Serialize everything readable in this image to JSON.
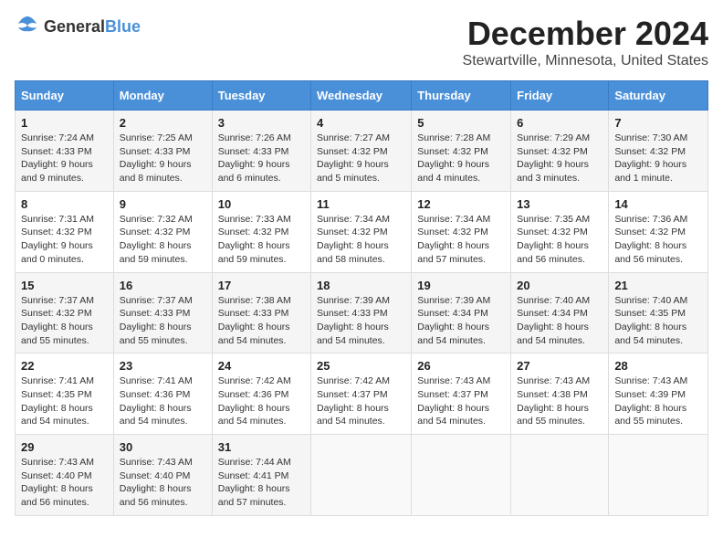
{
  "header": {
    "logo_general": "General",
    "logo_blue": "Blue",
    "title": "December 2024",
    "subtitle": "Stewartville, Minnesota, United States"
  },
  "days_of_week": [
    "Sunday",
    "Monday",
    "Tuesday",
    "Wednesday",
    "Thursday",
    "Friday",
    "Saturday"
  ],
  "weeks": [
    [
      {
        "day": "1",
        "sunrise": "7:24 AM",
        "sunset": "4:33 PM",
        "daylight": "9 hours and 9 minutes."
      },
      {
        "day": "2",
        "sunrise": "7:25 AM",
        "sunset": "4:33 PM",
        "daylight": "9 hours and 8 minutes."
      },
      {
        "day": "3",
        "sunrise": "7:26 AM",
        "sunset": "4:33 PM",
        "daylight": "9 hours and 6 minutes."
      },
      {
        "day": "4",
        "sunrise": "7:27 AM",
        "sunset": "4:32 PM",
        "daylight": "9 hours and 5 minutes."
      },
      {
        "day": "5",
        "sunrise": "7:28 AM",
        "sunset": "4:32 PM",
        "daylight": "9 hours and 4 minutes."
      },
      {
        "day": "6",
        "sunrise": "7:29 AM",
        "sunset": "4:32 PM",
        "daylight": "9 hours and 3 minutes."
      },
      {
        "day": "7",
        "sunrise": "7:30 AM",
        "sunset": "4:32 PM",
        "daylight": "9 hours and 1 minute."
      }
    ],
    [
      {
        "day": "8",
        "sunrise": "7:31 AM",
        "sunset": "4:32 PM",
        "daylight": "9 hours and 0 minutes."
      },
      {
        "day": "9",
        "sunrise": "7:32 AM",
        "sunset": "4:32 PM",
        "daylight": "8 hours and 59 minutes."
      },
      {
        "day": "10",
        "sunrise": "7:33 AM",
        "sunset": "4:32 PM",
        "daylight": "8 hours and 59 minutes."
      },
      {
        "day": "11",
        "sunrise": "7:34 AM",
        "sunset": "4:32 PM",
        "daylight": "8 hours and 58 minutes."
      },
      {
        "day": "12",
        "sunrise": "7:34 AM",
        "sunset": "4:32 PM",
        "daylight": "8 hours and 57 minutes."
      },
      {
        "day": "13",
        "sunrise": "7:35 AM",
        "sunset": "4:32 PM",
        "daylight": "8 hours and 56 minutes."
      },
      {
        "day": "14",
        "sunrise": "7:36 AM",
        "sunset": "4:32 PM",
        "daylight": "8 hours and 56 minutes."
      }
    ],
    [
      {
        "day": "15",
        "sunrise": "7:37 AM",
        "sunset": "4:32 PM",
        "daylight": "8 hours and 55 minutes."
      },
      {
        "day": "16",
        "sunrise": "7:37 AM",
        "sunset": "4:33 PM",
        "daylight": "8 hours and 55 minutes."
      },
      {
        "day": "17",
        "sunrise": "7:38 AM",
        "sunset": "4:33 PM",
        "daylight": "8 hours and 54 minutes."
      },
      {
        "day": "18",
        "sunrise": "7:39 AM",
        "sunset": "4:33 PM",
        "daylight": "8 hours and 54 minutes."
      },
      {
        "day": "19",
        "sunrise": "7:39 AM",
        "sunset": "4:34 PM",
        "daylight": "8 hours and 54 minutes."
      },
      {
        "day": "20",
        "sunrise": "7:40 AM",
        "sunset": "4:34 PM",
        "daylight": "8 hours and 54 minutes."
      },
      {
        "day": "21",
        "sunrise": "7:40 AM",
        "sunset": "4:35 PM",
        "daylight": "8 hours and 54 minutes."
      }
    ],
    [
      {
        "day": "22",
        "sunrise": "7:41 AM",
        "sunset": "4:35 PM",
        "daylight": "8 hours and 54 minutes."
      },
      {
        "day": "23",
        "sunrise": "7:41 AM",
        "sunset": "4:36 PM",
        "daylight": "8 hours and 54 minutes."
      },
      {
        "day": "24",
        "sunrise": "7:42 AM",
        "sunset": "4:36 PM",
        "daylight": "8 hours and 54 minutes."
      },
      {
        "day": "25",
        "sunrise": "7:42 AM",
        "sunset": "4:37 PM",
        "daylight": "8 hours and 54 minutes."
      },
      {
        "day": "26",
        "sunrise": "7:43 AM",
        "sunset": "4:37 PM",
        "daylight": "8 hours and 54 minutes."
      },
      {
        "day": "27",
        "sunrise": "7:43 AM",
        "sunset": "4:38 PM",
        "daylight": "8 hours and 55 minutes."
      },
      {
        "day": "28",
        "sunrise": "7:43 AM",
        "sunset": "4:39 PM",
        "daylight": "8 hours and 55 minutes."
      }
    ],
    [
      {
        "day": "29",
        "sunrise": "7:43 AM",
        "sunset": "4:40 PM",
        "daylight": "8 hours and 56 minutes."
      },
      {
        "day": "30",
        "sunrise": "7:43 AM",
        "sunset": "4:40 PM",
        "daylight": "8 hours and 56 minutes."
      },
      {
        "day": "31",
        "sunrise": "7:44 AM",
        "sunset": "4:41 PM",
        "daylight": "8 hours and 57 minutes."
      },
      null,
      null,
      null,
      null
    ]
  ],
  "labels": {
    "sunrise": "Sunrise:",
    "sunset": "Sunset:",
    "daylight": "Daylight:"
  }
}
